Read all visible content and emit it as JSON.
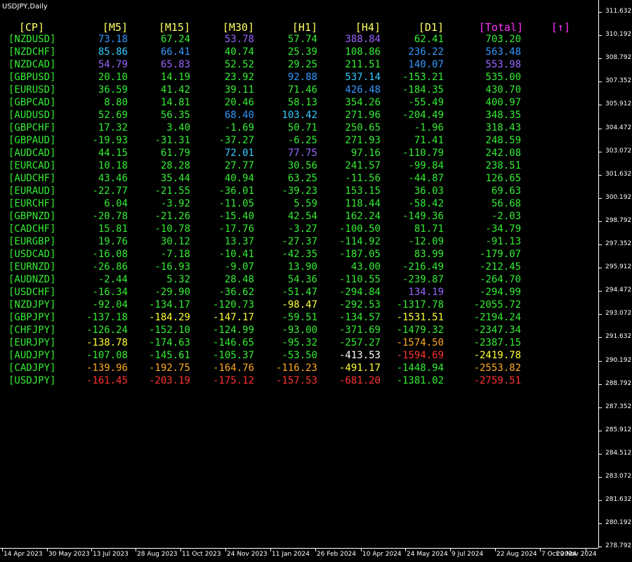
{
  "chart_title": "USDJPY,Daily",
  "headers": [
    "[CP]",
    "[M5]",
    "[M15]",
    "[M30]",
    "[H1]",
    "[H4]",
    "[D1]",
    "[Total]",
    "[↑]"
  ],
  "colors": {
    "header": "#ffff66",
    "total_header": "#ff33ff",
    "pair": "#33ee33",
    "green": "#33ee33",
    "blue": "#3399ff",
    "cyan": "#33ccff",
    "purple": "#9966ff",
    "yellow": "#ffff33",
    "orange": "#ffaa22",
    "red": "#ff3333",
    "white": "#ffffff"
  },
  "rows": [
    {
      "pair": "[NZDUSD]",
      "v": [
        "73.18",
        "67.24",
        "53.78",
        "57.74",
        "388.84",
        "62.41",
        "703.20"
      ],
      "c": [
        "blue",
        "green",
        "purple",
        "green",
        "purple",
        "green",
        "green"
      ]
    },
    {
      "pair": "[NZDCHF]",
      "v": [
        "85.86",
        "66.41",
        "40.74",
        "25.39",
        "108.86",
        "236.22",
        "563.48"
      ],
      "c": [
        "cyan",
        "blue",
        "green",
        "green",
        "green",
        "blue",
        "blue"
      ]
    },
    {
      "pair": "[NZDCAD]",
      "v": [
        "54.79",
        "65.83",
        "52.52",
        "29.25",
        "211.51",
        "140.07",
        "553.98"
      ],
      "c": [
        "purple",
        "purple",
        "green",
        "green",
        "green",
        "blue",
        "purple"
      ]
    },
    {
      "pair": "[GBPUSD]",
      "v": [
        "20.10",
        "14.19",
        "23.92",
        "92.88",
        "537.14",
        "-153.21",
        "535.00"
      ],
      "c": [
        "green",
        "green",
        "green",
        "blue",
        "cyan",
        "green",
        "green"
      ]
    },
    {
      "pair": "[EURUSD]",
      "v": [
        "36.59",
        "41.42",
        "39.11",
        "71.46",
        "426.48",
        "-184.35",
        "430.70"
      ],
      "c": [
        "green",
        "green",
        "green",
        "green",
        "blue",
        "green",
        "green"
      ]
    },
    {
      "pair": "[GBPCAD]",
      "v": [
        "8.80",
        "14.81",
        "20.46",
        "58.13",
        "354.26",
        "-55.49",
        "400.97"
      ],
      "c": [
        "green",
        "green",
        "green",
        "green",
        "green",
        "green",
        "green"
      ]
    },
    {
      "pair": "[AUDUSD]",
      "v": [
        "52.69",
        "56.35",
        "68.40",
        "103.42",
        "271.96",
        "-204.49",
        "348.35"
      ],
      "c": [
        "green",
        "green",
        "blue",
        "cyan",
        "green",
        "green",
        "green"
      ]
    },
    {
      "pair": "[GBPCHF]",
      "v": [
        "17.32",
        "3.40",
        "-1.69",
        "50.71",
        "250.65",
        "-1.96",
        "318.43"
      ],
      "c": [
        "green",
        "green",
        "green",
        "green",
        "green",
        "green",
        "green"
      ]
    },
    {
      "pair": "[GBPAUD]",
      "v": [
        "-19.93",
        "-31.31",
        "-37.27",
        "-6.25",
        "271.93",
        "71.41",
        "248.59"
      ],
      "c": [
        "green",
        "green",
        "green",
        "green",
        "green",
        "green",
        "green"
      ]
    },
    {
      "pair": "[AUDCAD]",
      "v": [
        "44.15",
        "61.79",
        "72.01",
        "77.75",
        "97.16",
        "-110.79",
        "242.08"
      ],
      "c": [
        "green",
        "green",
        "cyan",
        "purple",
        "green",
        "green",
        "green"
      ]
    },
    {
      "pair": "[EURCAD]",
      "v": [
        "10.18",
        "28.28",
        "27.77",
        "30.56",
        "241.57",
        "-99.84",
        "238.51"
      ],
      "c": [
        "green",
        "green",
        "green",
        "green",
        "green",
        "green",
        "green"
      ]
    },
    {
      "pair": "[AUDCHF]",
      "v": [
        "43.46",
        "35.44",
        "40.94",
        "63.25",
        "-11.56",
        "-44.87",
        "126.65"
      ],
      "c": [
        "green",
        "green",
        "green",
        "green",
        "green",
        "green",
        "green"
      ]
    },
    {
      "pair": "[EURAUD]",
      "v": [
        "-22.77",
        "-21.55",
        "-36.01",
        "-39.23",
        "153.15",
        "36.03",
        "69.63"
      ],
      "c": [
        "green",
        "green",
        "green",
        "green",
        "green",
        "green",
        "green"
      ]
    },
    {
      "pair": "[EURCHF]",
      "v": [
        "6.04",
        "-3.92",
        "-11.05",
        "5.59",
        "118.44",
        "-58.42",
        "56.68"
      ],
      "c": [
        "green",
        "green",
        "green",
        "green",
        "green",
        "green",
        "green"
      ]
    },
    {
      "pair": "[GBPNZD]",
      "v": [
        "-20.78",
        "-21.26",
        "-15.40",
        "42.54",
        "162.24",
        "-149.36",
        "-2.03"
      ],
      "c": [
        "green",
        "green",
        "green",
        "green",
        "green",
        "green",
        "green"
      ]
    },
    {
      "pair": "[CADCHF]",
      "v": [
        "15.81",
        "-10.78",
        "-17.76",
        "-3.27",
        "-100.50",
        "81.71",
        "-34.79"
      ],
      "c": [
        "green",
        "green",
        "green",
        "green",
        "green",
        "green",
        "green"
      ]
    },
    {
      "pair": "[EURGBP]",
      "v": [
        "19.76",
        "30.12",
        "13.37",
        "-27.37",
        "-114.92",
        "-12.09",
        "-91.13"
      ],
      "c": [
        "green",
        "green",
        "green",
        "green",
        "green",
        "green",
        "green"
      ]
    },
    {
      "pair": "[USDCAD]",
      "v": [
        "-16.08",
        "-7.18",
        "-10.41",
        "-42.35",
        "-187.05",
        "83.99",
        "-179.07"
      ],
      "c": [
        "green",
        "green",
        "green",
        "green",
        "green",
        "green",
        "green"
      ]
    },
    {
      "pair": "[EURNZD]",
      "v": [
        "-26.86",
        "-16.93",
        "-9.07",
        "13.90",
        "43.00",
        "-216.49",
        "-212.45"
      ],
      "c": [
        "green",
        "green",
        "green",
        "green",
        "green",
        "green",
        "green"
      ]
    },
    {
      "pair": "[AUDNZD]",
      "v": [
        "-2.44",
        "5.32",
        "28.48",
        "54.36",
        "-110.55",
        "-239.87",
        "-264.70"
      ],
      "c": [
        "green",
        "green",
        "green",
        "green",
        "green",
        "green",
        "green"
      ]
    },
    {
      "pair": "[USDCHF]",
      "v": [
        "-16.34",
        "-29.90",
        "-36.62",
        "-51.47",
        "-294.84",
        "134.19",
        "-294.99"
      ],
      "c": [
        "green",
        "green",
        "green",
        "green",
        "green",
        "purple",
        "green"
      ]
    },
    {
      "pair": "[NZDJPY]",
      "v": [
        "-92.04",
        "-134.17",
        "-120.73",
        "-98.47",
        "-292.53",
        "-1317.78",
        "-2055.72"
      ],
      "c": [
        "green",
        "green",
        "green",
        "yellow",
        "green",
        "green",
        "green"
      ]
    },
    {
      "pair": "[GBPJPY]",
      "v": [
        "-137.18",
        "-184.29",
        "-147.17",
        "-59.51",
        "-134.57",
        "-1531.51",
        "-2194.24"
      ],
      "c": [
        "green",
        "yellow",
        "yellow",
        "green",
        "green",
        "yellow",
        "green"
      ]
    },
    {
      "pair": "[CHFJPY]",
      "v": [
        "-126.24",
        "-152.10",
        "-124.99",
        "-93.00",
        "-371.69",
        "-1479.32",
        "-2347.34"
      ],
      "c": [
        "green",
        "green",
        "green",
        "green",
        "green",
        "green",
        "green"
      ]
    },
    {
      "pair": "[EURJPY]",
      "v": [
        "-138.78",
        "-174.63",
        "-146.65",
        "-95.32",
        "-257.27",
        "-1574.50",
        "-2387.15"
      ],
      "c": [
        "yellow",
        "green",
        "green",
        "green",
        "green",
        "orange",
        "green"
      ]
    },
    {
      "pair": "[AUDJPY]",
      "v": [
        "-107.08",
        "-145.61",
        "-105.37",
        "-53.50",
        "-413.53",
        "-1594.69",
        "-2419.78"
      ],
      "c": [
        "green",
        "green",
        "green",
        "green",
        "white",
        "red",
        "yellow"
      ]
    },
    {
      "pair": "[CADJPY]",
      "v": [
        "-139.96",
        "-192.75",
        "-164.76",
        "-116.23",
        "-491.17",
        "-1448.94",
        "-2553.82"
      ],
      "c": [
        "orange",
        "orange",
        "orange",
        "orange",
        "yellow",
        "green",
        "orange"
      ]
    },
    {
      "pair": "[USDJPY]",
      "v": [
        "-161.45",
        "-203.19",
        "-175.12",
        "-157.53",
        "-681.20",
        "-1381.02",
        "-2759.51"
      ],
      "c": [
        "red",
        "red",
        "red",
        "red",
        "red",
        "green",
        "red"
      ]
    }
  ],
  "price_axis": [
    "311.632",
    "310.192",
    "308.792",
    "307.352",
    "305.912",
    "304.472",
    "303.072",
    "301.632",
    "300.192",
    "298.792",
    "297.352",
    "295.912",
    "294.472",
    "293.072",
    "291.632",
    "290.192",
    "288.792",
    "287.352",
    "285.912",
    "284.512",
    "283.072",
    "281.632",
    "280.192",
    "278.792"
  ],
  "time_axis": [
    "14 Apr 2023",
    "30 May 2023",
    "13 Jul 2023",
    "28 Aug 2023",
    "11 Oct 2023",
    "24 Nov 2023",
    "11 Jan 2024",
    "26 Feb 2024",
    "10 Apr 2024",
    "24 May 2024",
    "9 Jul 2024",
    "22 Aug 2024",
    "7 Oct 2024",
    "20 Nov 2024"
  ]
}
